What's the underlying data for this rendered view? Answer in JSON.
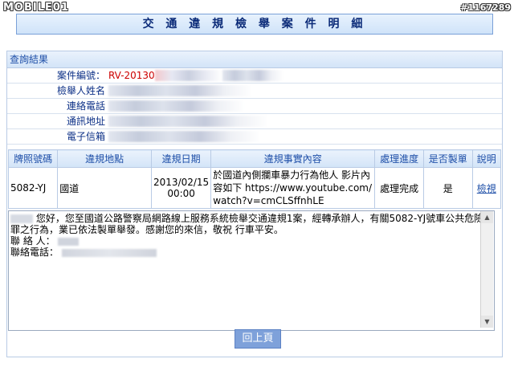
{
  "watermark": "MOBILE01",
  "post_id": "#1167289",
  "page_title": "交 通 違 規 檢 舉 案 件 明 細",
  "result_section": {
    "heading": "查詢結果",
    "fields": [
      {
        "label": "案件編號：",
        "value": "RV-20130"
      },
      {
        "label": "檢舉人姓名",
        "value": ""
      },
      {
        "label": "連絡電話",
        "value": ""
      },
      {
        "label": "通訊地址",
        "value": ""
      },
      {
        "label": "電子信箱",
        "value": ""
      }
    ]
  },
  "case_table": {
    "headers": [
      "牌照號碼",
      "違規地點",
      "違規日期",
      "違規事實內容",
      "處理進度",
      "是否製單",
      "說明"
    ],
    "rows": [
      {
        "plate": "5082-YJ",
        "location": "國道",
        "date": "2013/02/15 00:00",
        "content": "於國道內側攔車暴力行為他人 影片內容如下 https://www.youtube.com/watch?v=cmCLSffnhLE",
        "status": "處理完成",
        "ticketed": "是",
        "detail": "檢視"
      }
    ]
  },
  "reply": {
    "line1": "您好，您至國道公路警察局網路線上服務系統檢舉交通違規1案，經轉承辦人，有關5082-YJ號車公共危險罪之行為，業已依法製單舉發。感謝您的來信，敬祝 行車平安。",
    "contact_label": "聯 絡 人：",
    "phone_label": "聯絡電話："
  },
  "back_button": "回上頁"
}
